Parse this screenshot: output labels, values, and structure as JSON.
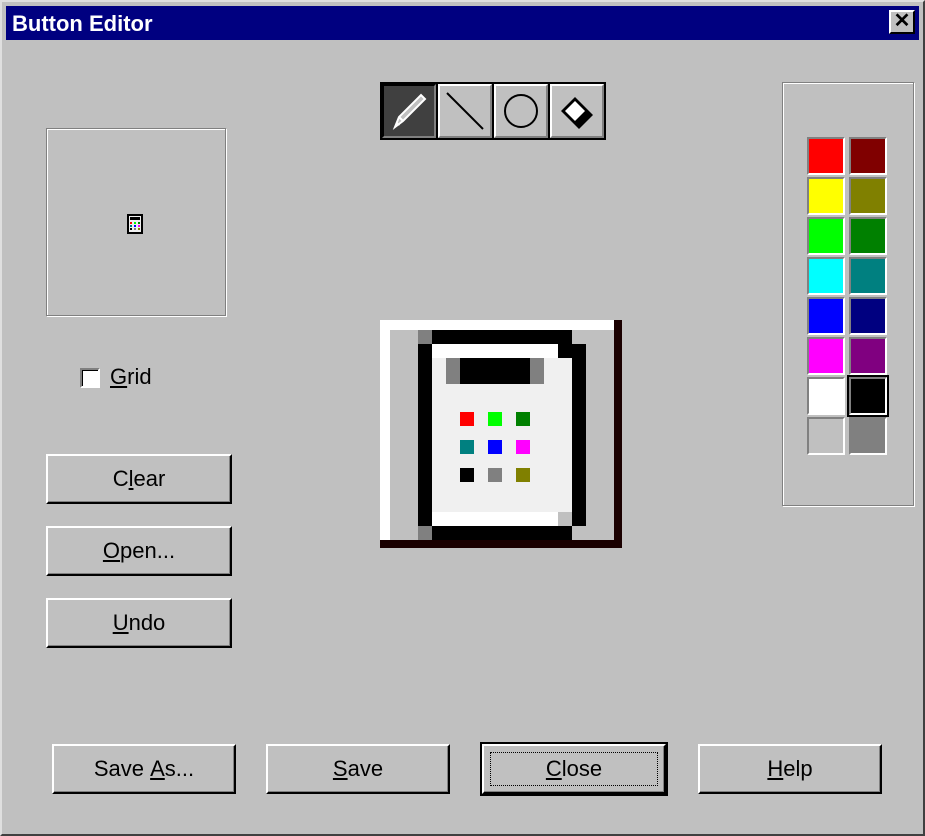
{
  "window": {
    "title": "Button Editor",
    "close_glyph": "✕"
  },
  "tools": [
    {
      "name": "pencil-icon",
      "active": true
    },
    {
      "name": "line-icon",
      "active": false
    },
    {
      "name": "circle-icon",
      "active": false
    },
    {
      "name": "eraser-icon",
      "active": false
    }
  ],
  "preview": {
    "icon": "calculator-icon"
  },
  "grid": {
    "mnemonic": "G",
    "rest": "rid",
    "checked": false
  },
  "side_buttons": {
    "clear": {
      "pre": "C",
      "mnemonic": "l",
      "post": "ear"
    },
    "open": {
      "pre": "",
      "mnemonic": "O",
      "post": "pen..."
    },
    "undo": {
      "pre": "",
      "mnemonic": "U",
      "post": "ndo"
    }
  },
  "bottom_buttons": {
    "save_as": {
      "pre": "Save ",
      "mnemonic": "A",
      "post": "s..."
    },
    "save": {
      "pre": "",
      "mnemonic": "S",
      "post": "ave"
    },
    "close": {
      "pre": "",
      "mnemonic": "C",
      "post": "lose"
    },
    "help": {
      "pre": "",
      "mnemonic": "H",
      "post": "elp"
    }
  },
  "palette": {
    "colors": [
      [
        "#ff0000",
        "#800000"
      ],
      [
        "#ffff00",
        "#808000"
      ],
      [
        "#00ff00",
        "#008000"
      ],
      [
        "#00ffff",
        "#008080"
      ],
      [
        "#0000ff",
        "#000080"
      ],
      [
        "#ff00ff",
        "#800080"
      ],
      [
        "#ffffff",
        "#000000"
      ],
      [
        "#c0c0c0",
        "#808080"
      ]
    ],
    "selected_foreground": "#000000"
  },
  "canvas": {
    "key_colors": [
      [
        "#ff0000",
        "#00ff00",
        "#008000"
      ],
      [
        "#008080",
        "#0000ff",
        "#ff00ff"
      ],
      [
        "#000000",
        "#808080",
        "#808000"
      ]
    ]
  }
}
